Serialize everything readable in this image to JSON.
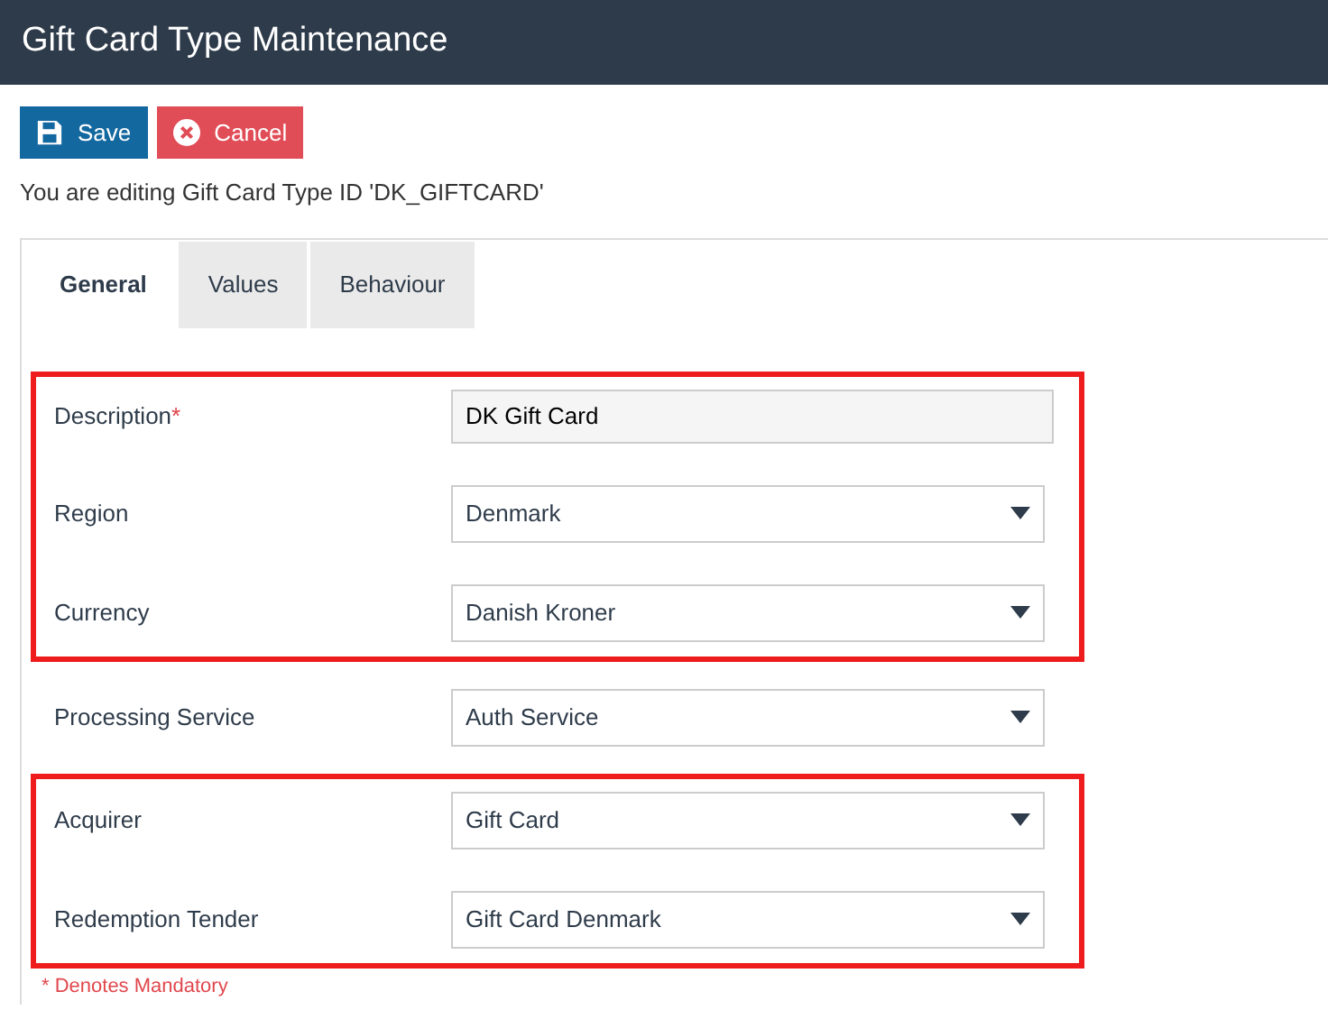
{
  "header": {
    "title": "Gift Card Type Maintenance"
  },
  "toolbar": {
    "buttons": [
      {
        "kind": "save",
        "label": "Save"
      },
      {
        "kind": "cancel",
        "label": "Cancel"
      }
    ]
  },
  "editing_note": "You are editing Gift Card Type ID 'DK_GIFTCARD'",
  "tabs": [
    {
      "label": "General",
      "selected": true
    },
    {
      "label": "Values",
      "selected": false
    },
    {
      "label": "Behaviour",
      "selected": false
    }
  ],
  "field_groups": [
    {
      "highlighted": true,
      "fields": [
        {
          "kind": "text",
          "label": "Description",
          "required_mark": "*",
          "value": "DK Gift Card"
        },
        {
          "kind": "select",
          "label": "Region",
          "value": "Denmark"
        },
        {
          "kind": "select",
          "label": "Currency",
          "value": "Danish Kroner"
        }
      ]
    },
    {
      "highlighted": false,
      "fields": [
        {
          "kind": "select",
          "label": "Processing Service",
          "value": "Auth Service"
        }
      ]
    },
    {
      "highlighted": true,
      "fields": [
        {
          "kind": "select",
          "label": "Acquirer",
          "value": "Gift Card"
        },
        {
          "kind": "select",
          "label": "Redemption Tender",
          "value": "Gift Card Denmark"
        }
      ]
    }
  ],
  "mandatory_note": "* Denotes Mandatory"
}
